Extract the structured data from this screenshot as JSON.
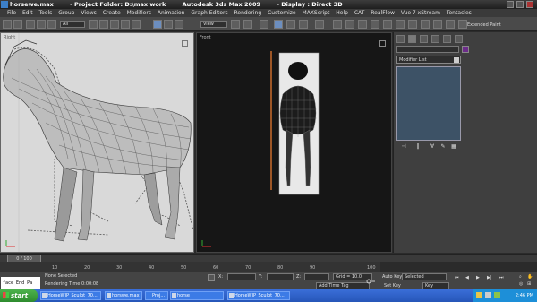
{
  "window": {
    "file": "horsewe.max",
    "project": "- Project Folder: D:\\max work",
    "app": "Autodesk 3ds Max  2009",
    "display": "- Display : Direct 3D"
  },
  "menu": [
    "File",
    "Edit",
    "Tools",
    "Group",
    "Views",
    "Create",
    "Modifiers",
    "Animation",
    "Graph Editors",
    "Rendering",
    "Customize",
    "MAXScript",
    "Help",
    "CAT",
    "RealFlow",
    "Vue 7 xStream",
    "Tentacles"
  ],
  "toolbar": {
    "selection_filter": "All",
    "reference_coord": "View",
    "extended_label": "Extended Paint"
  },
  "viewports": {
    "left_label": "Right",
    "front_label": "Front"
  },
  "command_panel": {
    "modifier_list": "Modifier List"
  },
  "timeline": {
    "frame_counter": "0 / 100",
    "ticks": [
      "10",
      "20",
      "30",
      "40",
      "50",
      "60",
      "70",
      "80",
      "90",
      "100"
    ]
  },
  "status": {
    "maxscript": "face End Pa",
    "none_selected": "None Selected",
    "rendering_time": "Rendering Time  0:00:08",
    "x_label": "X:",
    "y_label": "Y:",
    "z_label": "Z:",
    "grid": "Grid = 10.0",
    "add_time_tag": "Add Time Tag",
    "auto_key": "Auto Key",
    "auto_key_value": "Selected",
    "set_key": "Set Key",
    "key_filters": "Key Filters..."
  },
  "taskbar": {
    "start": "start",
    "items": [
      "HorseWIP_Sculpt_70...",
      "horswe.max",
      "Proj...",
      "horse",
      "HorseWIP_Sculpt_70..."
    ],
    "clock": "2:46 PM"
  },
  "colors": {
    "accent": "#3c7be6",
    "object_color": "#6c2c8a",
    "stack_bg": "#3d5266"
  }
}
